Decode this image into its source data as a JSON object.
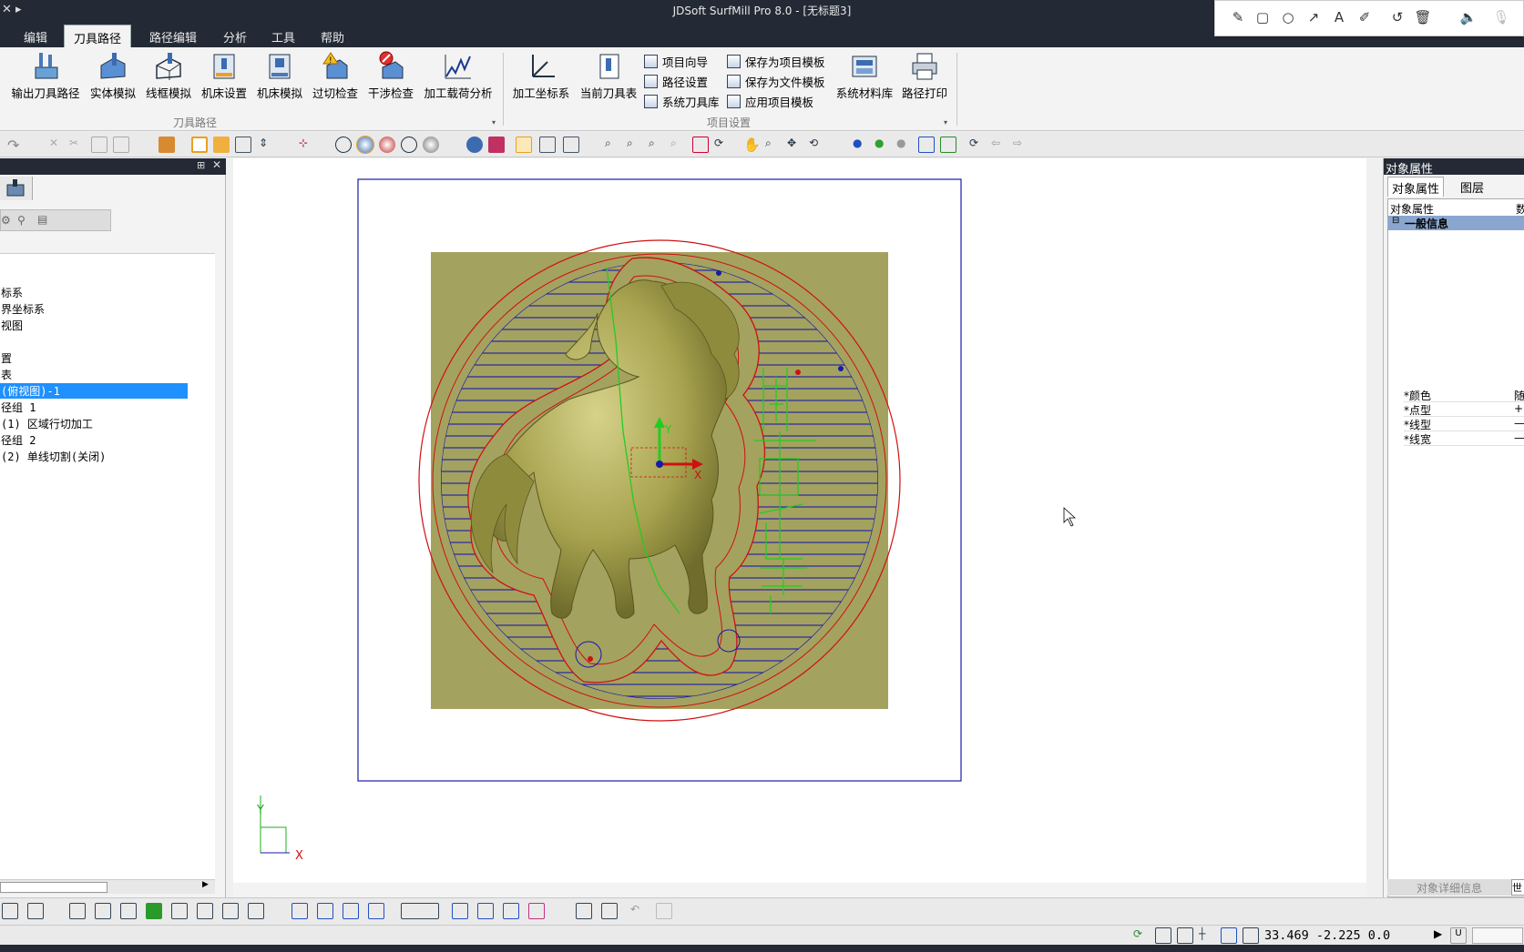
{
  "window": {
    "title": "JDSoft SurfMill Pro 8.0 - [无标题3]"
  },
  "menu": {
    "tabs": [
      {
        "label": "编辑"
      },
      {
        "label": "刀具路径",
        "active": true
      },
      {
        "label": "路径编辑"
      },
      {
        "label": "分析"
      },
      {
        "label": "工具"
      },
      {
        "label": "帮助"
      }
    ]
  },
  "ribbon": {
    "toolpath_group": {
      "label": "刀具路径",
      "buttons": [
        "输出刀具路径",
        "实体模拟",
        "线框模拟",
        "机床设置",
        "机床模拟",
        "过切检查",
        "干涉检查",
        "加工载荷分析"
      ]
    },
    "project_group": {
      "label": "项目设置",
      "large_buttons": [
        "加工坐标系",
        "当前刀具表"
      ],
      "small_buttons": [
        "项目向导",
        "路径设置",
        "系统刀具库",
        "保存为项目模板",
        "保存为文件模板",
        "应用项目模板"
      ],
      "right_buttons": [
        "系统材料库",
        "路径打印"
      ]
    }
  },
  "tree": {
    "nodes": [
      {
        "label": "标系"
      },
      {
        "label": "界坐标系"
      },
      {
        "label": "视图"
      },
      {
        "label": "置"
      },
      {
        "label": "表"
      },
      {
        "label": "(俯视图)-1",
        "selected": true
      },
      {
        "label": "径组 1"
      },
      {
        "label": "(1) 区域行切加工"
      },
      {
        "label": "径组 2"
      },
      {
        "label": "(2) 单线切割(关闭)"
      }
    ]
  },
  "properties": {
    "header": "对象属性",
    "tabs": [
      "对象属性",
      "图层"
    ],
    "columns": [
      "对象属性",
      "数"
    ],
    "group": "一般信息",
    "rows": [
      "*颜色",
      "*点型",
      "*线型",
      "*线宽"
    ],
    "row_values": [
      "随",
      "+",
      "—",
      "—"
    ],
    "footer": "对象详细信息",
    "footer_right": "世"
  },
  "status": {
    "coords": "33.469 -2.225 0.0",
    "u_label": "U"
  },
  "canvas": {
    "axis_x": "X",
    "axis_y": "Y",
    "gizmo_x": "X",
    "gizmo_y": "Y"
  },
  "icons": [
    "pencil-icon",
    "rectangle-icon",
    "circle-icon",
    "arrow-icon",
    "text-icon",
    "highlighter-icon",
    "undo-icon",
    "trash-icon",
    "speaker-icon",
    "mic-off-icon"
  ],
  "colors": {
    "titlebar": "#232a35",
    "selection": "#1e90ff",
    "toolpath_blue": "#1a1aa8",
    "boundary_red": "#d01010",
    "cut_green": "#22cc22",
    "stock": "#a4a25f"
  }
}
